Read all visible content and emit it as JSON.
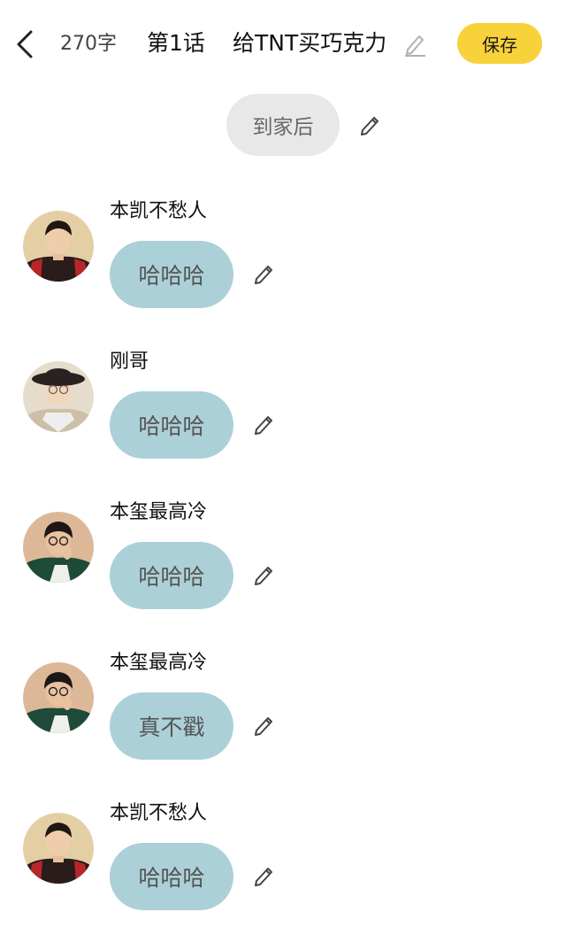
{
  "header": {
    "word_count": "270字",
    "chapter": "第1话",
    "title": "给TNT买巧克力",
    "save_label": "保存"
  },
  "scene": {
    "label": "到家后"
  },
  "messages": [
    {
      "sender": "本凯不愁人",
      "text": "哈哈哈",
      "avatar": "avatar-a"
    },
    {
      "sender": "刚哥",
      "text": "哈哈哈",
      "avatar": "avatar-b"
    },
    {
      "sender": "本玺最高冷",
      "text": "哈哈哈",
      "avatar": "avatar-c"
    },
    {
      "sender": "本玺最高冷",
      "text": "真不戳",
      "avatar": "avatar-c"
    },
    {
      "sender": "本凯不愁人",
      "text": "哈哈哈",
      "avatar": "avatar-a"
    }
  ],
  "colors": {
    "save_button": "#f8d23a",
    "message_bubble": "#acd0d8",
    "scene_bubble": "#e8e8e8"
  }
}
